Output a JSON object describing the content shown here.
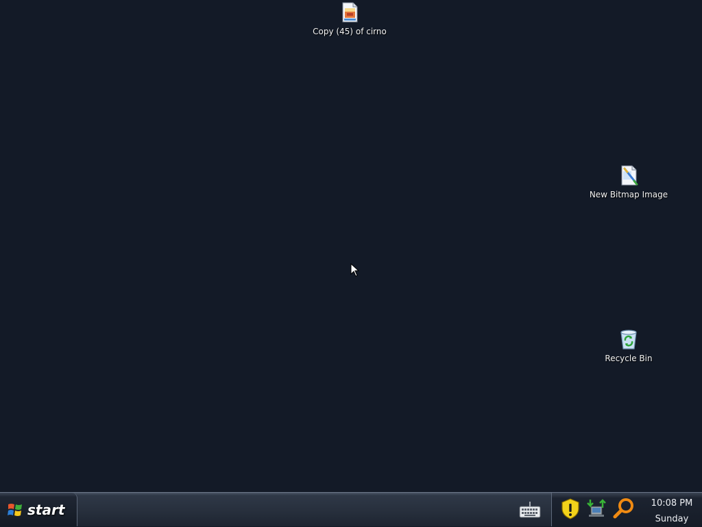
{
  "desktop": {
    "icons": [
      {
        "label": "Copy (45) of cirno",
        "icon": "image-file-icon"
      },
      {
        "label": "New Bitmap Image",
        "icon": "bitmap-paint-icon"
      },
      {
        "label": "Recycle Bin",
        "icon": "recycle-bin-icon"
      }
    ]
  },
  "taskbar": {
    "start_label": "start",
    "quick_icon": "keyboard-icon",
    "tray": {
      "icons": [
        "security-shield-icon",
        "network-icon",
        "search-icon"
      ],
      "time": "10:08 PM",
      "day": "Sunday"
    }
  },
  "colors": {
    "desktop_bg": "#131a27",
    "taskbar_bg": "#262e3b",
    "shield_yellow": "#f3d21a",
    "search_orange": "#f08a12"
  }
}
